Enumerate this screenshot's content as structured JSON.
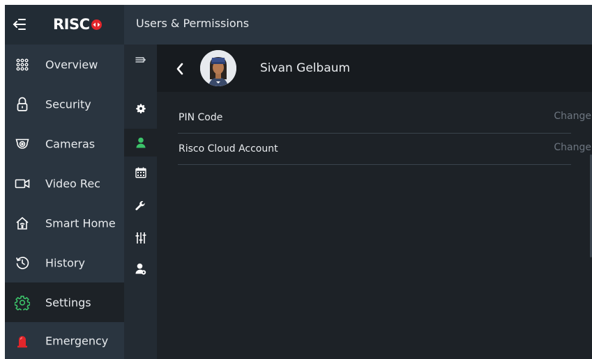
{
  "brand": {
    "logo_text": "RISC",
    "accent": "#e2262b"
  },
  "header": {
    "title": "Users & Permissions"
  },
  "sidebar": {
    "items": [
      {
        "label": "Overview",
        "icon": "grid-dots-icon"
      },
      {
        "label": "Security",
        "icon": "padlock-icon"
      },
      {
        "label": "Cameras",
        "icon": "camera-icon"
      },
      {
        "label": "Video Rec",
        "icon": "video-camera-icon"
      },
      {
        "label": "Smart Home",
        "icon": "smart-home-icon"
      },
      {
        "label": "History",
        "icon": "history-clock-icon"
      },
      {
        "label": "Settings",
        "icon": "gear-icon",
        "active": true,
        "color": "#3cc36a"
      },
      {
        "label": "Emergency",
        "icon": "siren-icon",
        "color": "#e2262b"
      }
    ]
  },
  "rail": {
    "icons": [
      "expand-arrow-icon",
      "gear-icon",
      "user-icon",
      "calendar-icon",
      "wrench-icon",
      "sliders-icon",
      "user-settings-icon"
    ],
    "active": "user-icon",
    "active_color": "#3cc36a"
  },
  "user": {
    "name": "Sivan Gelbaum"
  },
  "settings": [
    {
      "label": "PIN Code",
      "action": "Change"
    },
    {
      "label": "Risco Cloud Account",
      "action": "Change"
    }
  ]
}
